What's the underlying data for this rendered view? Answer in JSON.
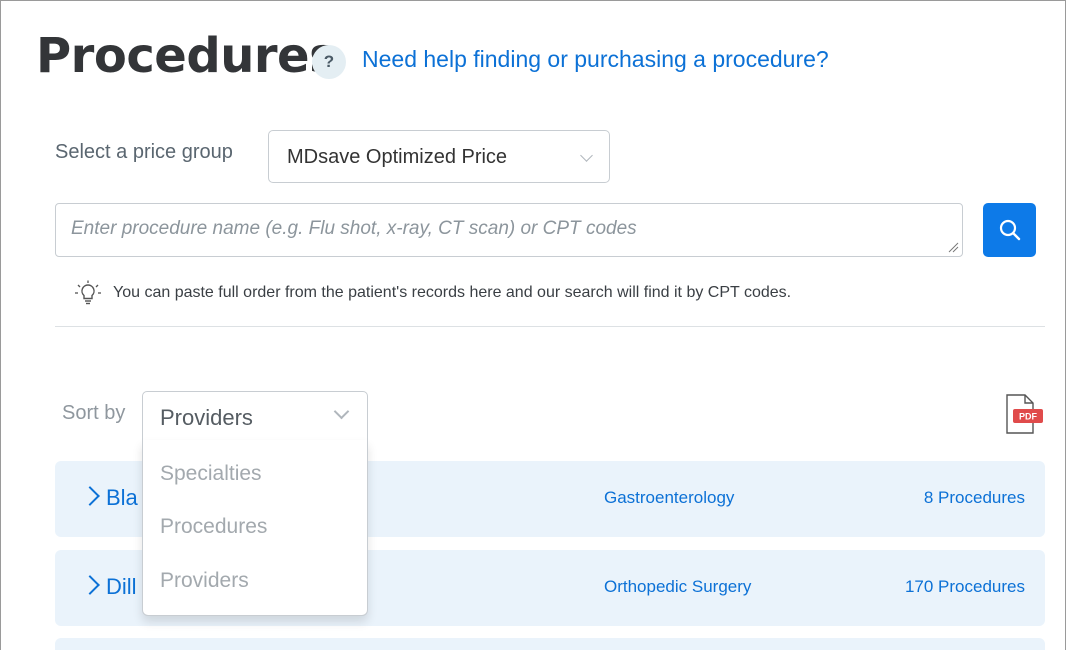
{
  "page": {
    "title": "Procedures",
    "help_icon_glyph": "?",
    "help_link": "Need help finding or purchasing a procedure?"
  },
  "price_group": {
    "label": "Select a price group",
    "selected": "MDsave Optimized Price"
  },
  "search": {
    "placeholder": "Enter procedure name (e.g. Flu shot, x-ray, CT scan) or CPT codes",
    "value": "",
    "button_icon": "search-icon"
  },
  "tip": {
    "icon": "lightbulb-icon",
    "text": "You can paste full order from the patient's records here and our search will find it by CPT codes."
  },
  "sort": {
    "label": "Sort by",
    "selected": "Providers",
    "options": [
      "Specialties",
      "Procedures",
      "Providers"
    ]
  },
  "export": {
    "icon": "pdf-icon",
    "badge": "PDF"
  },
  "providers": [
    {
      "name": "Bla",
      "specialty": "Gastroenterology",
      "count": "8 Procedures"
    },
    {
      "name": "Dill",
      "specialty": "Orthopedic Surgery",
      "count": "170 Procedures"
    }
  ],
  "colors": {
    "accent": "#0c71d6",
    "button": "#0d7ae8",
    "row_bg": "#eaf3fb",
    "pdf_badge": "#e04b4b"
  }
}
